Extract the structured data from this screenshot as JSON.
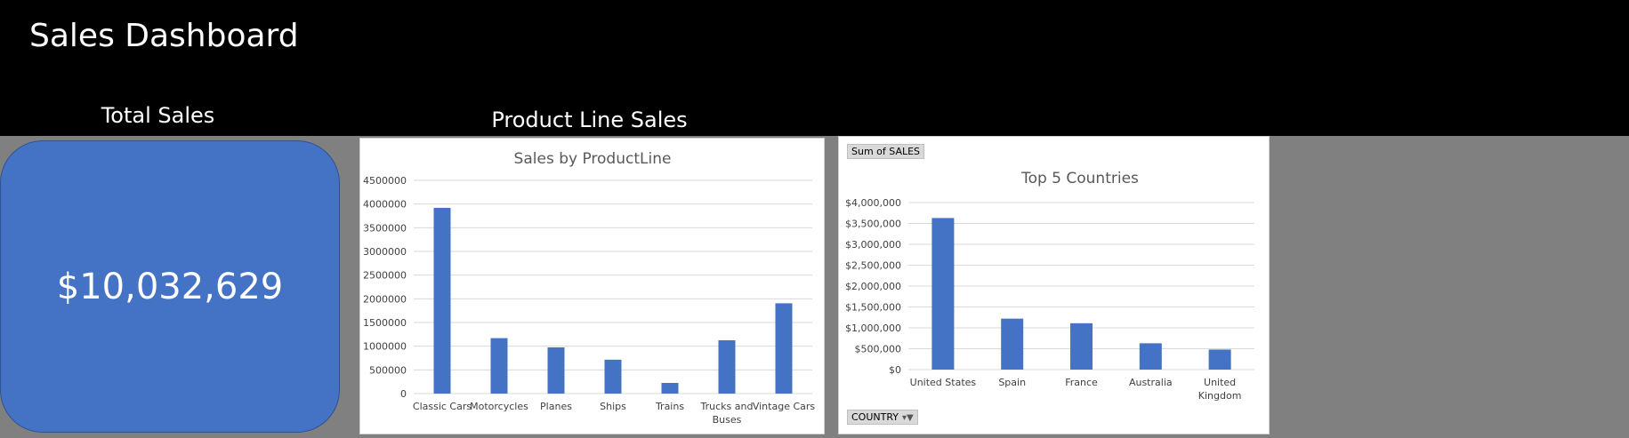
{
  "dashboard": {
    "title": "Sales Dashboard",
    "total_sales_heading": "Total Sales",
    "total_sales_value": "$10,032,629",
    "product_line_heading": "Product Line Sales"
  },
  "colors": {
    "bar": "#4472c4",
    "banner": "#000000",
    "background": "#808080"
  },
  "pivot": {
    "sum_field_label": "Sum of SALES",
    "axis_field_label": "COUNTRY",
    "axis_field_icon": "filter-dropdown-icon"
  },
  "chart_data": [
    {
      "type": "bar",
      "title": "Sales by ProductLine",
      "categories": [
        "Classic Cars",
        "Motorcycles",
        "Planes",
        "Ships",
        "Trains",
        "Trucks and Buses",
        "Vintage Cars"
      ],
      "category_lines": [
        [
          "Classic Cars"
        ],
        [
          "Motorcycles"
        ],
        [
          "Planes"
        ],
        [
          "Ships"
        ],
        [
          "Trains"
        ],
        [
          "Trucks and",
          "Buses"
        ],
        [
          "Vintage Cars"
        ]
      ],
      "values": [
        3920000,
        1170000,
        975000,
        715000,
        225000,
        1125000,
        1905000
      ],
      "ylim": [
        0,
        4500000
      ],
      "yticks": [
        0,
        500000,
        1000000,
        1500000,
        2000000,
        2500000,
        3000000,
        3500000,
        4000000,
        4500000
      ],
      "ytick_labels": [
        "0",
        "500000",
        "1000000",
        "1500000",
        "2000000",
        "2500000",
        "3000000",
        "3500000",
        "4000000",
        "4500000"
      ],
      "grid": true,
      "legend": "none"
    },
    {
      "type": "bar",
      "title": "Top 5 Countries",
      "categories": [
        "United States",
        "Spain",
        "France",
        "Australia",
        "United Kingdom"
      ],
      "category_lines": [
        [
          "United States"
        ],
        [
          "Spain"
        ],
        [
          "France"
        ],
        [
          "Australia"
        ],
        [
          "United",
          "Kingdom"
        ]
      ],
      "values": [
        3630000,
        1220000,
        1110000,
        630000,
        480000
      ],
      "ylim": [
        0,
        4000000
      ],
      "yticks": [
        0,
        500000,
        1000000,
        1500000,
        2000000,
        2500000,
        3000000,
        3500000,
        4000000
      ],
      "ytick_labels": [
        "$0",
        "$500,000",
        "$1,000,000",
        "$1,500,000",
        "$2,000,000",
        "$2,500,000",
        "$3,000,000",
        "$3,500,000",
        "$4,000,000"
      ],
      "grid": true,
      "legend": "none"
    }
  ]
}
